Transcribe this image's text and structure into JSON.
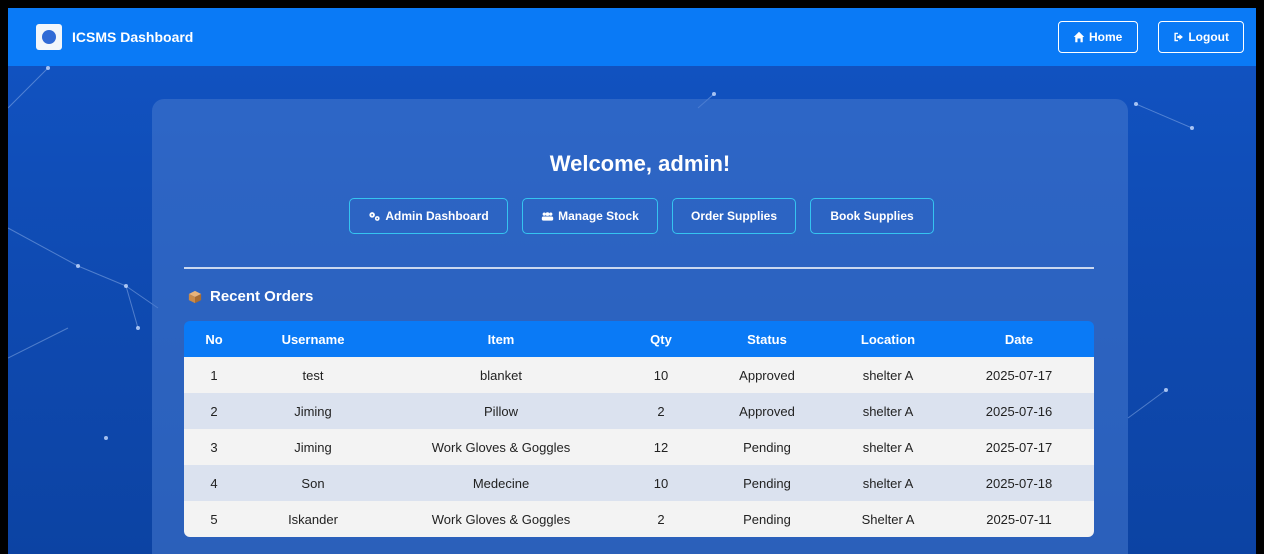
{
  "navbar": {
    "title": "ICSMS Dashboard",
    "home_label": "Home",
    "logout_label": "Logout"
  },
  "main": {
    "welcome": "Welcome, admin!",
    "actions": [
      {
        "label": "Admin Dashboard",
        "icon": "cogs-icon"
      },
      {
        "label": "Manage Stock",
        "icon": "users-icon"
      },
      {
        "label": "Order Supplies"
      },
      {
        "label": "Book Supplies"
      }
    ],
    "recent_orders_title": "Recent Orders"
  },
  "table": {
    "headers": [
      "No",
      "Username",
      "Item",
      "Qty",
      "Status",
      "Location",
      "Date"
    ],
    "rows": [
      [
        "1",
        "test",
        "blanket",
        "10",
        "Approved",
        "shelter A",
        "2025-07-17"
      ],
      [
        "2",
        "Jiming",
        "Pillow",
        "2",
        "Approved",
        "shelter A",
        "2025-07-16"
      ],
      [
        "3",
        "Jiming",
        "Work Gloves & Goggles",
        "12",
        "Pending",
        "shelter A",
        "2025-07-17"
      ],
      [
        "4",
        "Son",
        "Medecine",
        "10",
        "Pending",
        "shelter A",
        "2025-07-18"
      ],
      [
        "5",
        "Iskander",
        "Work Gloves & Goggles",
        "2",
        "Pending",
        "Shelter A",
        "2025-07-11"
      ]
    ]
  },
  "colors": {
    "navbar": "#0a7af6",
    "accent_border": "#35c4f0",
    "background": "#0f4bb3"
  }
}
